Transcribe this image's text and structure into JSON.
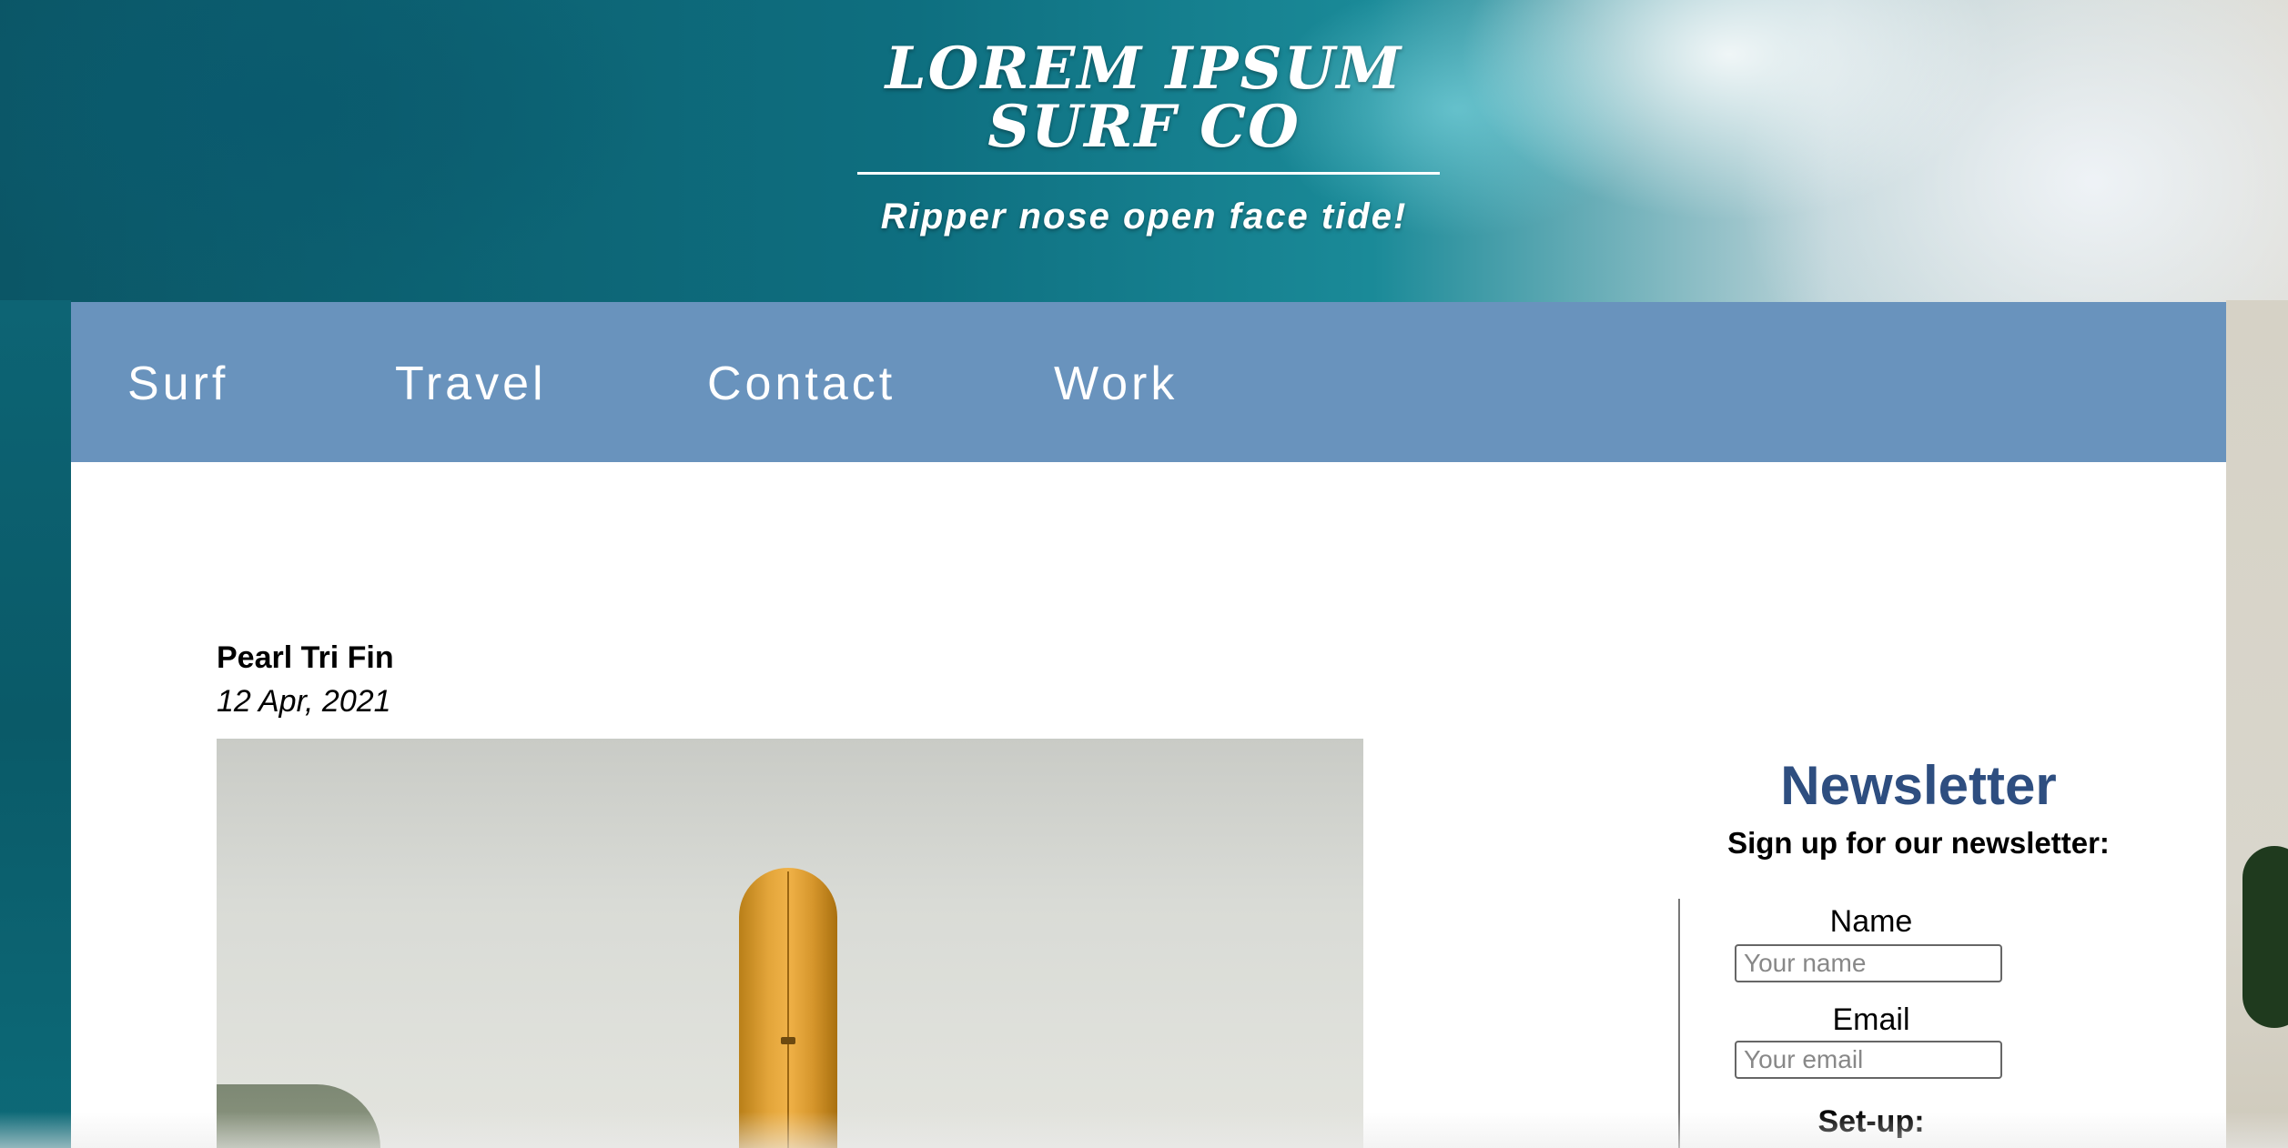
{
  "header": {
    "title_line1": "LOREM IPSUM",
    "title_line2": "SURF CO",
    "tagline": "Ripper nose open face tide!"
  },
  "nav": {
    "items": [
      {
        "label": "Surf"
      },
      {
        "label": "Travel"
      },
      {
        "label": "Contact"
      },
      {
        "label": "Work"
      }
    ]
  },
  "post": {
    "title": "Pearl Tri Fin",
    "date": "12 Apr, 2021"
  },
  "sidebar": {
    "heading": "Newsletter",
    "subheading": "Sign up for our newsletter:",
    "form": {
      "name_label": "Name",
      "name_placeholder": "Your name",
      "email_label": "Email",
      "email_placeholder": "Your email",
      "setup_label": "Set-up:"
    }
  },
  "colors": {
    "nav_bg": "#6993bd",
    "heading_accent": "#2e4e80",
    "page_bg": "#ffffff"
  }
}
